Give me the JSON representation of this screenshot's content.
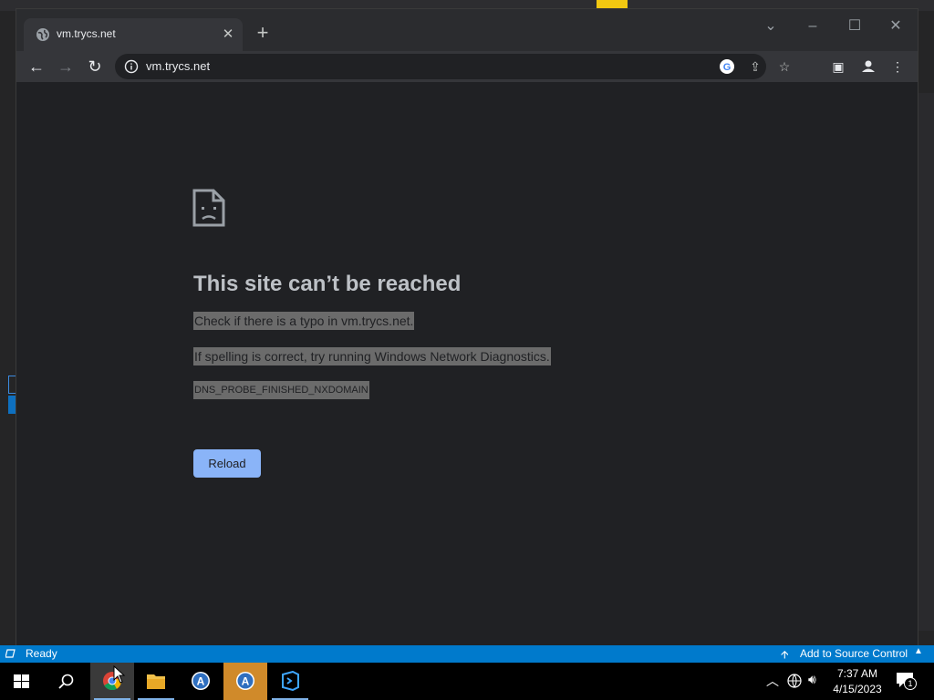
{
  "browser": {
    "tab": {
      "title": "vm.trycs.net"
    },
    "address": {
      "url": "vm.trycs.net"
    }
  },
  "error_page": {
    "title": "This site can’t be reached",
    "line1": "Check if there is a typo in vm.trycs.net.",
    "line2": "If spelling is correct, try running Windows Network Diagnostics.",
    "code": "DNS_PROBE_FINISHED_NXDOMAIN",
    "reload_label": "Reload"
  },
  "status_bar": {
    "ready": "Ready",
    "source_control": "Add to Source Control"
  },
  "taskbar": {
    "time": "7:37 AM",
    "date": "4/15/2023",
    "notification_count": "1"
  },
  "colors": {
    "accent_blue": "#8ab4f8",
    "status_bar": "#007acc",
    "page_background": "#202124"
  }
}
